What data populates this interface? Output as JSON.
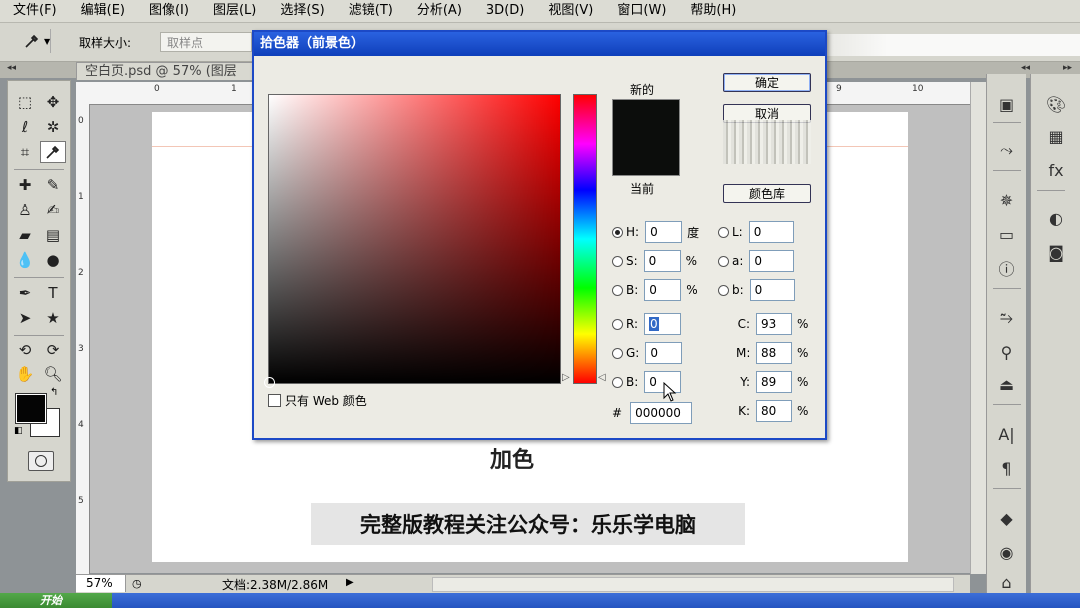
{
  "menu": [
    "文件(F)",
    "编辑(E)",
    "图像(I)",
    "图层(L)",
    "选择(S)",
    "滤镜(T)",
    "分析(A)",
    "3D(D)",
    "视图(V)",
    "窗口(W)",
    "帮助(H)"
  ],
  "options_bar": {
    "sample_size_label": "取样大小:",
    "sample_size_value": "取样点"
  },
  "document": {
    "tab_title": "空白页.psd @ 57% (图层",
    "ruler_top": [
      "0",
      "1",
      "9",
      "10"
    ],
    "ruler_left": [
      "0",
      "1",
      "2",
      "3",
      "4",
      "5"
    ],
    "zoom": "57%",
    "doc_size": "文档:2.38M/2.86M",
    "canvas_text": "加色",
    "banner": "完整版教程关注公众号：乐乐学电脑"
  },
  "taskbar": {
    "start": "开始"
  },
  "color_picker": {
    "title": "拾色器（前景色）",
    "new_label": "新的",
    "current_label": "当前",
    "ok": "确定",
    "cancel": "取消",
    "color_library": "颜色库",
    "web_only": "只有 Web 颜色",
    "hsb": [
      {
        "key": "H:",
        "value": "0",
        "unit": "度",
        "selected": true
      },
      {
        "key": "S:",
        "value": "0",
        "unit": "%"
      },
      {
        "key": "B:",
        "value": "0",
        "unit": "%"
      }
    ],
    "lab": [
      {
        "key": "L:",
        "value": "0"
      },
      {
        "key": "a:",
        "value": "0"
      },
      {
        "key": "b:",
        "value": "0"
      }
    ],
    "rgb": [
      {
        "key": "R:",
        "value": "0"
      },
      {
        "key": "G:",
        "value": "0"
      },
      {
        "key": "B:",
        "value": "0"
      }
    ],
    "cmyk": [
      {
        "key": "C:",
        "value": "93",
        "unit": "%"
      },
      {
        "key": "M:",
        "value": "88",
        "unit": "%"
      },
      {
        "key": "Y:",
        "value": "89",
        "unit": "%"
      },
      {
        "key": "K:",
        "value": "80",
        "unit": "%"
      }
    ],
    "hex_label": "#",
    "hex": "000000",
    "new_color": "#0c0d0c",
    "current_color": "#0c0d0c"
  },
  "colors": {
    "title_bar": "#1c49c6",
    "foreground": "#050505",
    "background": "#ffffff"
  }
}
